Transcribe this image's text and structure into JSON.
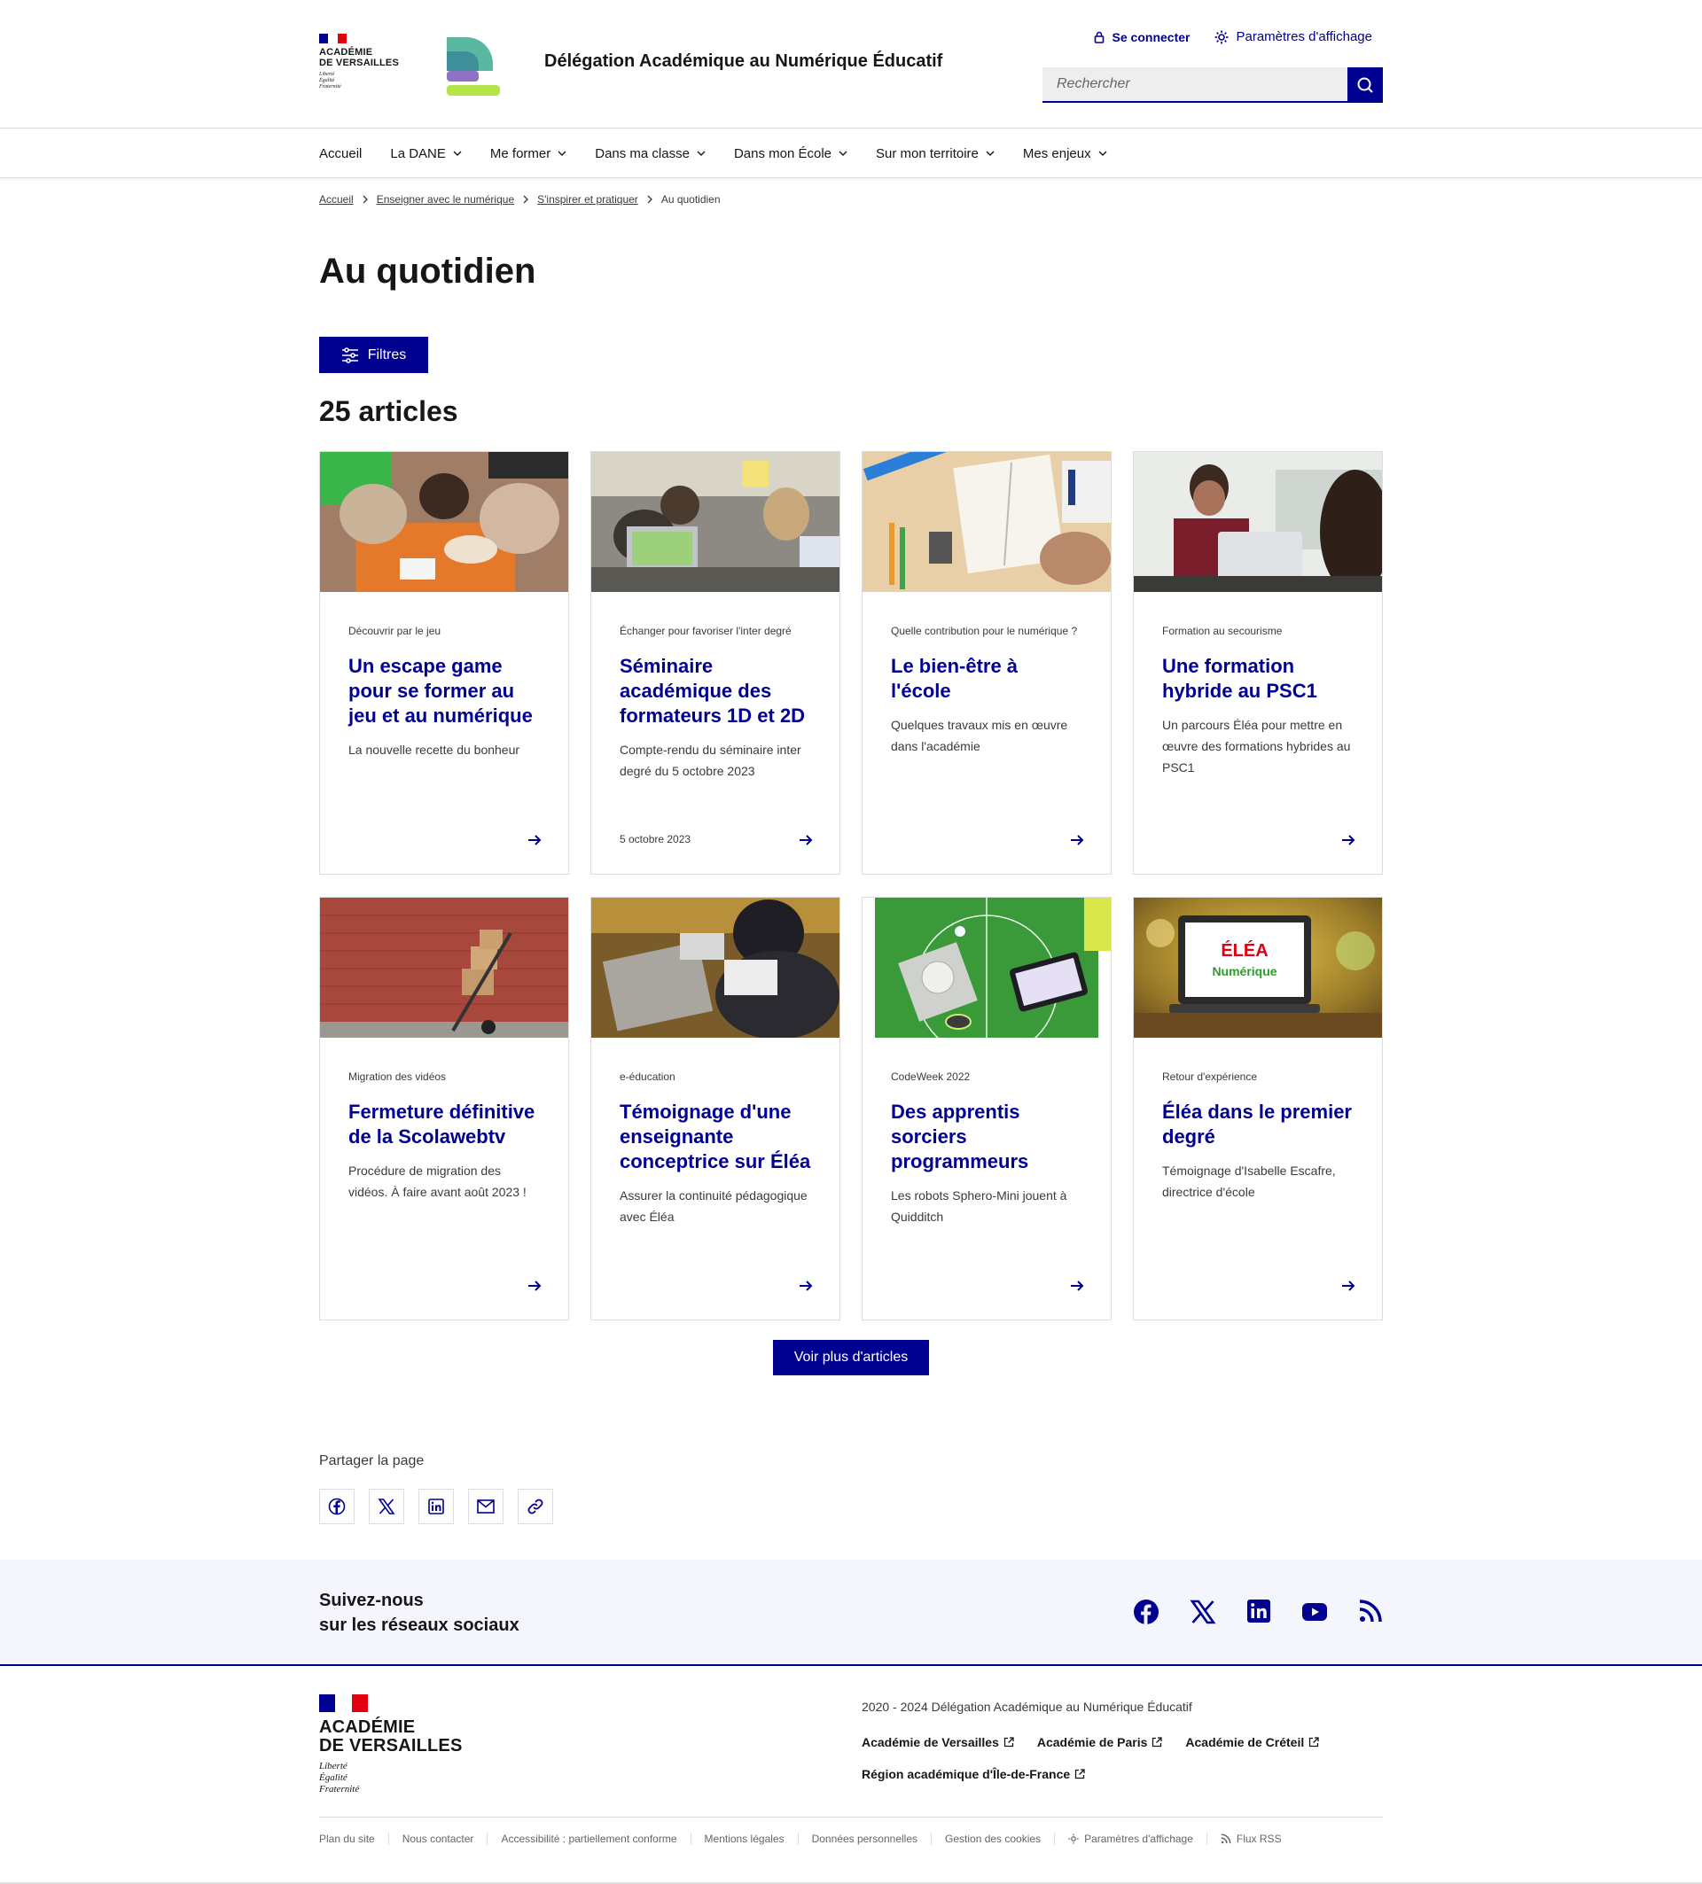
{
  "header": {
    "logo": {
      "name_line1": "ACADÉMIE",
      "name_line2": "DE VERSAILLES",
      "motto1": "Liberté",
      "motto2": "Égalité",
      "motto3": "Fraternité"
    },
    "site_title": "Délégation Académique au Numérique Éducatif",
    "login_label": "Se connecter",
    "display_settings_label": "Paramètres d'affichage",
    "search_placeholder": "Rechercher"
  },
  "nav": {
    "items": [
      {
        "label": "Accueil",
        "has_menu": false
      },
      {
        "label": "La DANE",
        "has_menu": true
      },
      {
        "label": "Me former",
        "has_menu": true
      },
      {
        "label": "Dans ma classe",
        "has_menu": true
      },
      {
        "label": "Dans mon École",
        "has_menu": true
      },
      {
        "label": "Sur mon territoire",
        "has_menu": true
      },
      {
        "label": "Mes enjeux",
        "has_menu": true
      }
    ]
  },
  "breadcrumb": {
    "items": [
      "Accueil",
      "Enseigner avec le numérique",
      "S'inspirer et pratiquer"
    ],
    "current": "Au quotidien"
  },
  "page": {
    "title": "Au quotidien",
    "filters_label": "Filtres",
    "count_heading": "25 articles",
    "more_label": "Voir plus d'articles"
  },
  "cards": [
    {
      "detail": "Découvrir par le jeu",
      "title": "Un escape game pour se former au jeu et au numérique",
      "desc": "La nouvelle recette du bonheur",
      "date": ""
    },
    {
      "detail": "Échanger pour favoriser l'inter degré",
      "title": "Séminaire académique des formateurs 1D et 2D",
      "desc": "Compte-rendu du séminaire inter degré du 5 octobre 2023",
      "date": "5 octobre 2023"
    },
    {
      "detail": "Quelle contribution pour le numérique ?",
      "title": "Le bien-être à l'école",
      "desc": "Quelques travaux mis en œuvre dans l'académie",
      "date": ""
    },
    {
      "detail": "Formation au secourisme",
      "title": "Une formation hybride au PSC1",
      "desc": "Un parcours Éléa pour mettre en œuvre des formations hybrides au PSC1",
      "date": ""
    },
    {
      "detail": "Migration des vidéos",
      "title": "Fermeture définitive de la Scolawebtv",
      "desc": "Procédure de migration des vidéos. À faire avant août 2023 !",
      "date": ""
    },
    {
      "detail": "e-éducation",
      "title": "Témoignage d'une enseignante conceptrice sur Éléa",
      "desc": "Assurer la continuité pédagogique avec Éléa",
      "date": ""
    },
    {
      "detail": "CodeWeek 2022",
      "title": "Des apprentis sorciers programmeurs",
      "desc": "Les robots Sphero-Mini jouent à Quidditch",
      "date": ""
    },
    {
      "detail": "Retour d'expérience",
      "title": "Éléa dans le premier degré",
      "desc": "Témoignage d'Isabelle Escafre, directrice d'école",
      "date": ""
    }
  ],
  "thumb_texts": {
    "elea_line1": "ÉLÉA",
    "elea_line2": "Numérique"
  },
  "share": {
    "label": "Partager la page",
    "buttons": [
      "facebook-icon",
      "x-icon",
      "linkedin-icon",
      "mail-icon",
      "link-icon"
    ]
  },
  "follow": {
    "line1": "Suivez-nous",
    "line2": "sur les réseaux sociaux",
    "networks": [
      "facebook-icon",
      "x-icon",
      "linkedin-icon",
      "youtube-icon",
      "rss-icon"
    ]
  },
  "footer": {
    "description": "2020 - 2024 Délégation Académique au Numérique Éducatif",
    "links": [
      "Académie de Versailles",
      "Académie de Paris",
      "Académie de Créteil",
      "Région académique d'Île-de-France"
    ],
    "bottom_links": [
      "Plan du site",
      "Nous contacter",
      "Accessibilité : partiellement conforme",
      "Mentions légales",
      "Données personnelles",
      "Gestion des cookies",
      "Paramètres d'affichage",
      "Flux RSS"
    ]
  },
  "colors": {
    "primary": "#000091",
    "text": "#161616",
    "muted": "#3a3a3a",
    "border": "#dddddd",
    "follow_bg": "#f5f5fe",
    "marianne_red": "#e1000f"
  }
}
